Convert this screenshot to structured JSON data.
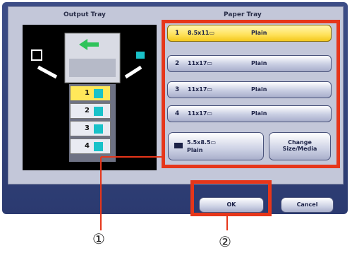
{
  "output_tray": {
    "title": "Output Tray",
    "bins": [
      "1",
      "2",
      "3",
      "4"
    ]
  },
  "paper_tray": {
    "title": "Paper Tray",
    "trays": [
      {
        "num": "1",
        "size": "8.5x11▭",
        "media": "Plain",
        "selected": true
      },
      {
        "num": "2",
        "size": "11x17▭",
        "media": "Plain",
        "selected": false
      },
      {
        "num": "3",
        "size": "11x17▭",
        "media": "Plain",
        "selected": false
      },
      {
        "num": "4",
        "size": "11x17▭",
        "media": "Plain",
        "selected": false
      }
    ],
    "bypass": {
      "size": "5.5x8.5▭",
      "media": "Plain"
    },
    "change_button": {
      "line1": "Change",
      "line2": "Size/Media"
    }
  },
  "footer": {
    "ok_label": "OK",
    "cancel_label": "Cancel"
  },
  "callouts": {
    "one": "①",
    "two": "②"
  },
  "colors": {
    "panel": "#2b3a70",
    "highlight": "#e6361a",
    "selected_tray": "#ffe25a",
    "bin_cyan": "#19c2c9"
  }
}
